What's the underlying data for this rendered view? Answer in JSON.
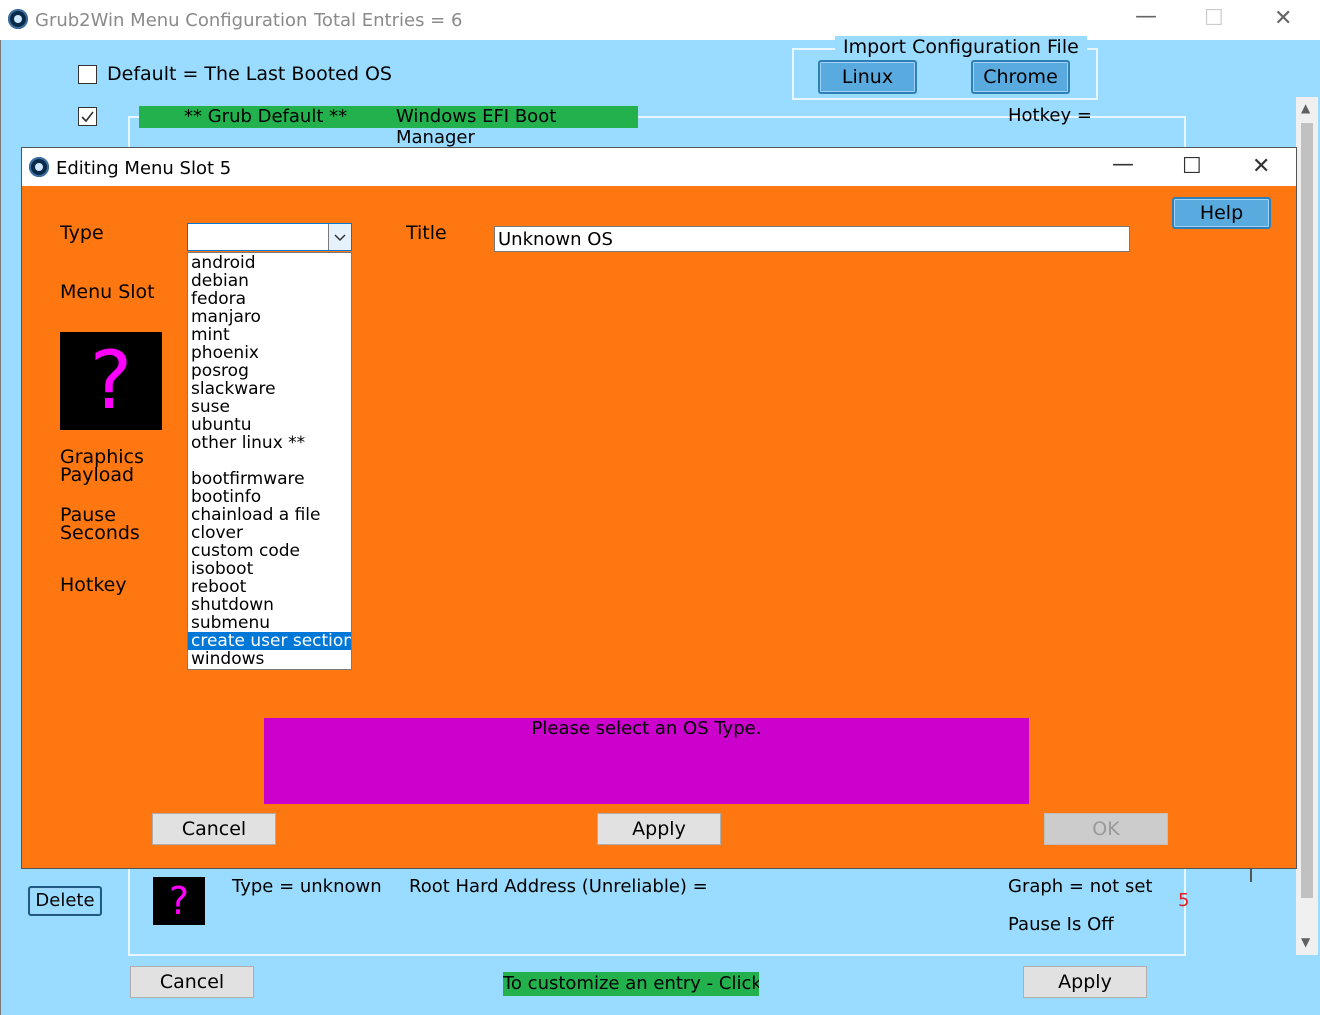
{
  "window": {
    "title": "Grub2Win Menu Configuration",
    "total_entries": "Total Entries  =  6",
    "minimize": "—",
    "maximize": "☐",
    "close": "✕"
  },
  "main": {
    "default_checkbox_label": "Default = The Last Booted OS",
    "default_checked": false,
    "grub_default_checked": true,
    "import_group_label": "Import Configuration File",
    "linux_button": "Linux",
    "chrome_button": "Chrome",
    "grub_default_tag": "** Grub Default **",
    "grub_default_entry": "Windows EFI Boot Manager",
    "hotkey_label": "Hotkey =",
    "delete_button": "Delete",
    "entry_type": "Type = unknown",
    "root_address": "Root Hard Address (Unreliable) =",
    "graph": "Graph = not set",
    "pause": "Pause Is Off",
    "slot_number": "5",
    "cancel_button": "Cancel",
    "apply_button": "Apply",
    "customize_hint": "To customize an entry - Click",
    "scroll_up": "▲",
    "scroll_down": "▼"
  },
  "dialog": {
    "title": "Editing Menu Slot 5",
    "minimize": "—",
    "maximize": "☐",
    "close": "✕",
    "help_button": "Help",
    "type_label": "Type",
    "type_value": "",
    "title_label": "Title",
    "title_value": "Unknown OS",
    "menu_slot_label": "Menu Slot",
    "graphics_label": "Graphics\nPayload",
    "pause_label": "Pause\nSeconds",
    "hotkey_label": "Hotkey",
    "os_icon_glyph": "?",
    "message": "Please select an OS Type.",
    "cancel_button": "Cancel",
    "apply_button": "Apply",
    "ok_button": "OK",
    "type_options_linux": [
      "android",
      "debian",
      "fedora",
      "manjaro",
      "mint",
      "phoenix",
      "posrog",
      "slackware",
      "suse",
      "ubuntu",
      "other linux **"
    ],
    "type_options_other": [
      "bootfirmware",
      "bootinfo",
      "chainload a file",
      "clover",
      "custom code",
      "isoboot",
      "reboot",
      "shutdown",
      "submenu",
      "create user section",
      "windows"
    ],
    "type_selected": "create user section"
  },
  "colors": {
    "main_bg": "#99dcff",
    "dialog_bg": "#ff7711",
    "green": "#22b14c",
    "magenta": "#cc00cc",
    "button_blue": "#58aadf",
    "selection": "#0078d7"
  },
  "icons": {
    "app": "grub2win-icon",
    "checkbox": "checkbox-icon",
    "dropdown": "chevron-down-icon",
    "unknown_os": "question-mark-icon"
  }
}
